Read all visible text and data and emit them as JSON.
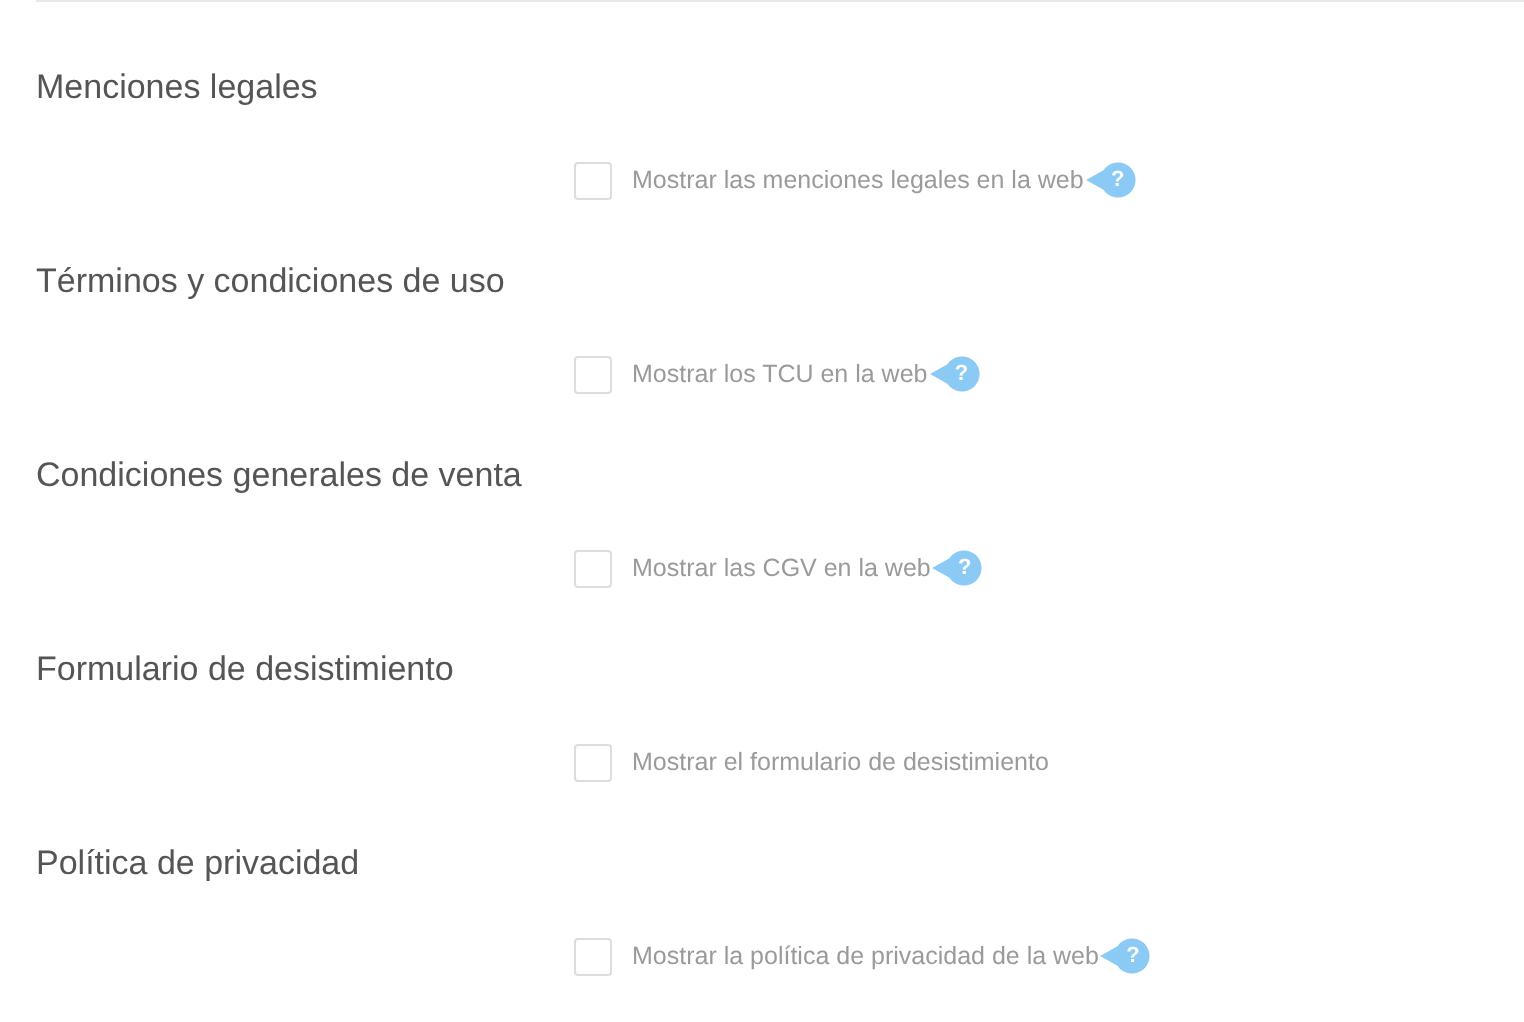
{
  "sections": [
    {
      "title": "Menciones legales",
      "option": {
        "label": "Mostrar las menciones legales en la web",
        "checked": false,
        "help": "?"
      }
    },
    {
      "title": "Términos y condiciones de uso",
      "option": {
        "label": "Mostrar los TCU en la web",
        "checked": false,
        "help": "?"
      }
    },
    {
      "title": "Condiciones generales de venta",
      "option": {
        "label": "Mostrar las CGV en la web",
        "checked": false,
        "help": "?"
      }
    },
    {
      "title": "Formulario de desistimiento",
      "option": {
        "label": "Mostrar el formulario de desistimiento",
        "checked": false
      }
    },
    {
      "title": "Política de privacidad",
      "option": {
        "label": "Mostrar la política de privacidad de la web",
        "checked": false,
        "help": "?"
      }
    }
  ]
}
